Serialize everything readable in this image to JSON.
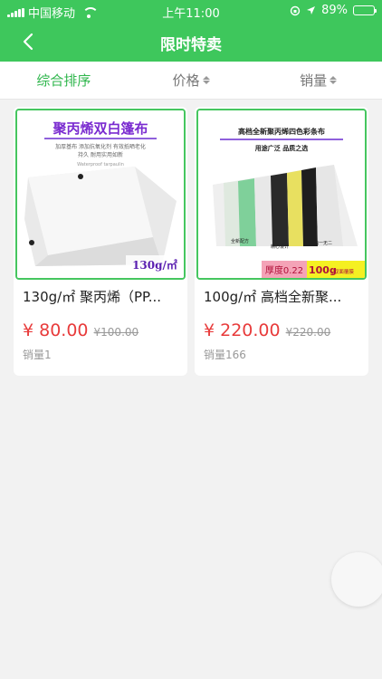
{
  "status": {
    "carrier": "中国移动",
    "time": "上午11:00",
    "battery": "89%",
    "battery_level": 0.89
  },
  "nav": {
    "title": "限时特卖"
  },
  "sort": {
    "items": [
      {
        "label": "综合排序",
        "active": true
      },
      {
        "label": "价格",
        "active": false
      },
      {
        "label": "销量",
        "active": false
      }
    ]
  },
  "products": [
    {
      "image": {
        "title": "聚丙烯双白篷布",
        "lines": [
          "加厚基布 添加抗氧化剂 有效抵晒老化",
          "持久 耐用实用如新"
        ],
        "english": "Waterproof tarpaulin",
        "badge": "130g/㎡"
      },
      "name": "130g/㎡ 聚丙烯（PP...",
      "price": "¥ 80.00",
      "old_price": "¥100.00",
      "sales": "销量1"
    },
    {
      "image": {
        "title": "高档全新聚丙烯四色彩条布",
        "slogan": "用途广泛  品质之选",
        "captions": [
          "全新配方",
          "精心设计",
          "独一无二"
        ],
        "badge_thickness": "厚度0.22",
        "badge_weight": "100g",
        "badge_weight_note": "/双面覆膜"
      },
      "name": "100g/㎡ 高档全新聚...",
      "price": "¥ 220.00",
      "old_price": "¥220.00",
      "sales": "销量166"
    }
  ]
}
